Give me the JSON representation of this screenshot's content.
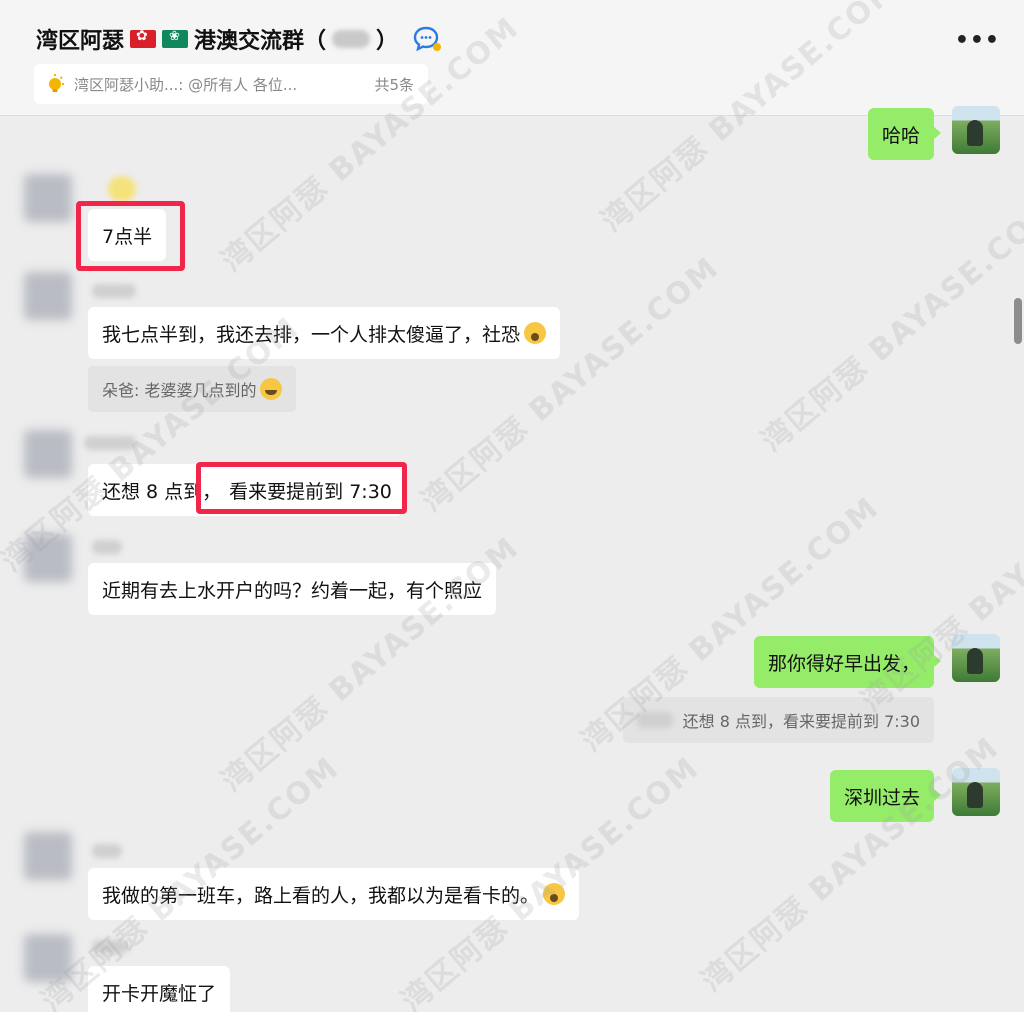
{
  "header": {
    "title_prefix": "湾区阿瑟",
    "title_suffix": "港澳交流群（",
    "title_close": "）",
    "more_label": "•••"
  },
  "pinned": {
    "text": "湾区阿瑟小助...: @所有人  各位...",
    "count": "共5条"
  },
  "messages": {
    "m0": "哈哈",
    "m1": "7点半",
    "m2": "我七点半到，我还去排，一个人排太傻逼了，社恐",
    "m2_quote": "朵爸: 老婆婆几点到的",
    "m3_a": "还想 8 点到，",
    "m3_b": "看来要提前到 7:30",
    "m4": "近期有去上水开户的吗？约着一起，有个照应",
    "m5": "那你得好早出发，",
    "m5_quote": "还想 8 点到，看来要提前到 7:30",
    "m6": "深圳过去",
    "m7": "我做的第一班车，路上看的人，我都以为是看卡的。",
    "m8": "开卡开魔怔了"
  },
  "watermark": "湾区阿瑟 BAYASE.COM",
  "colors": {
    "my_bubble": "#95ec69",
    "highlight": "#f0274a",
    "background": "#ededed"
  }
}
